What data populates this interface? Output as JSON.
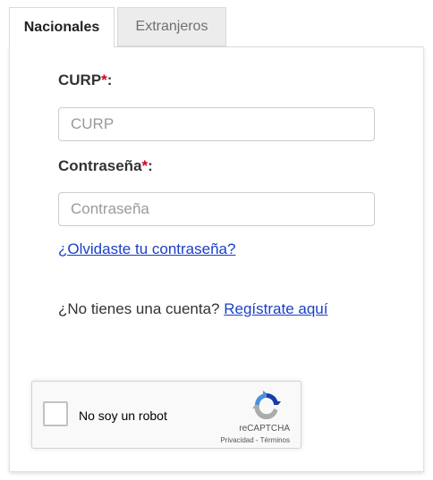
{
  "tabs": {
    "active_label": "Nacionales",
    "inactive_label": "Extranjeros"
  },
  "form": {
    "curp_label": "CURP",
    "curp_placeholder": "CURP",
    "password_label": "Contraseña",
    "password_placeholder": "Contraseña",
    "required_mark": "*",
    "label_colon": ":",
    "forgot_link": "¿Olvidaste tu contraseña?",
    "no_account_text": "¿No tienes una cuenta?",
    "register_link": "Regístrate aquí"
  },
  "recaptcha": {
    "checkbox_label": "No soy un robot",
    "brand": "reCAPTCHA",
    "privacy": "Privacidad",
    "separator": " - ",
    "terms": "Términos"
  },
  "colors": {
    "required": "#d0021b",
    "link": "#1a3fc8",
    "recaptcha_blue": "#1c3aa9",
    "recaptcha_light_blue": "#4a90e2",
    "recaptcha_gray": "#ababab"
  }
}
